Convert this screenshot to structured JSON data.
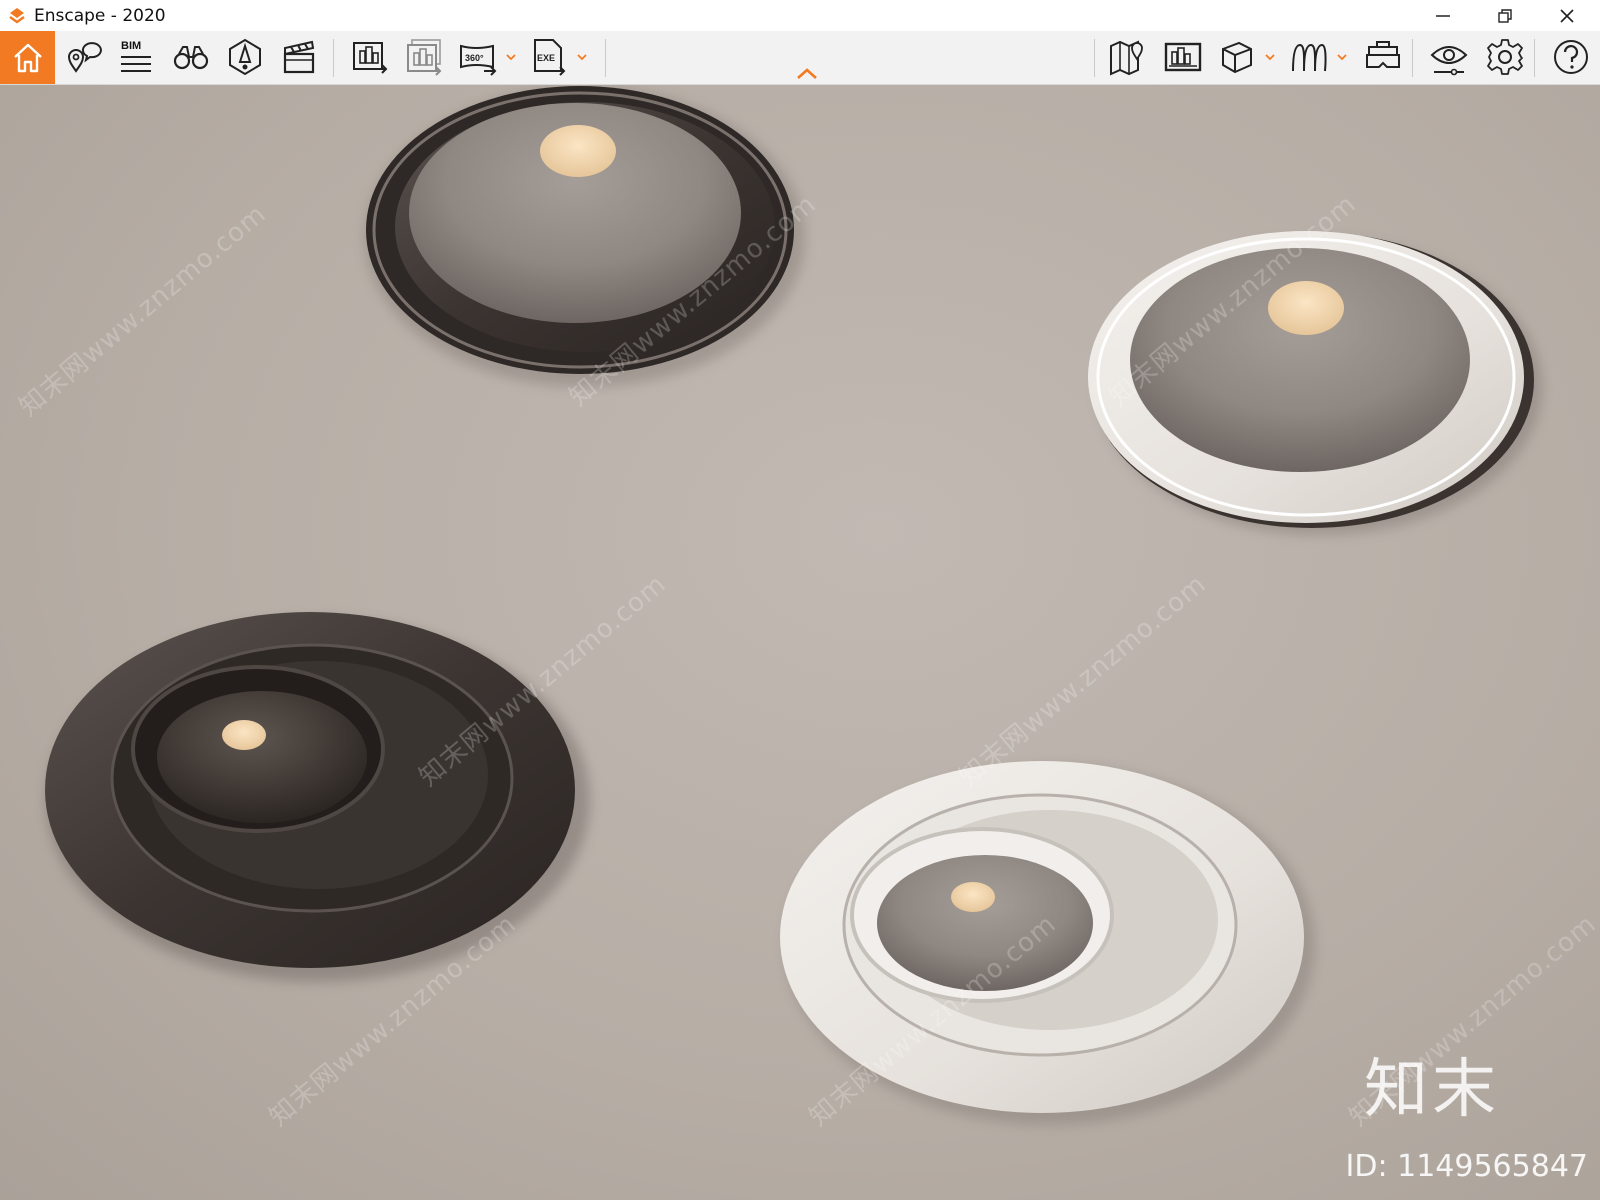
{
  "window": {
    "title": "Enscape - 2020",
    "controls": [
      "minimize-icon",
      "restore-icon",
      "close-icon"
    ]
  },
  "toolbar": {
    "accent": "#f27a22",
    "bim_label": "BIM",
    "left_buttons": [
      {
        "icon": "home-icon"
      },
      {
        "icon": "location-pin-chat-icon"
      },
      {
        "icon": "bim-info-icon"
      },
      {
        "icon": "binoculars-icon"
      },
      {
        "icon": "navigation-mode-icon"
      },
      {
        "icon": "clapperboard-icon"
      },
      {
        "icon": "render-image-export-icon"
      },
      {
        "icon": "batch-render-icon"
      },
      {
        "icon": "panorama-360-icon"
      },
      {
        "icon": "exe-export-icon"
      }
    ],
    "right_buttons": [
      {
        "icon": "map-icon"
      },
      {
        "icon": "asset-library-icon"
      },
      {
        "icon": "cube-view-icon"
      },
      {
        "icon": "material-editor-icon"
      },
      {
        "icon": "vr-headset-icon"
      },
      {
        "icon": "visual-settings-eye-icon"
      },
      {
        "icon": "settings-gear-icon"
      },
      {
        "icon": "help-icon"
      }
    ],
    "badge_360": "360°",
    "badge_exe": "EXE"
  },
  "viewport": {
    "description_objects": [
      "dark-downlight-fixed",
      "white-downlight-fixed",
      "dark-downlight-adjustable",
      "white-downlight-adjustable"
    ],
    "watermark_text": "知末网www.znzmo.com",
    "brand_mark": "知末",
    "image_id": "ID: 1149565847"
  }
}
